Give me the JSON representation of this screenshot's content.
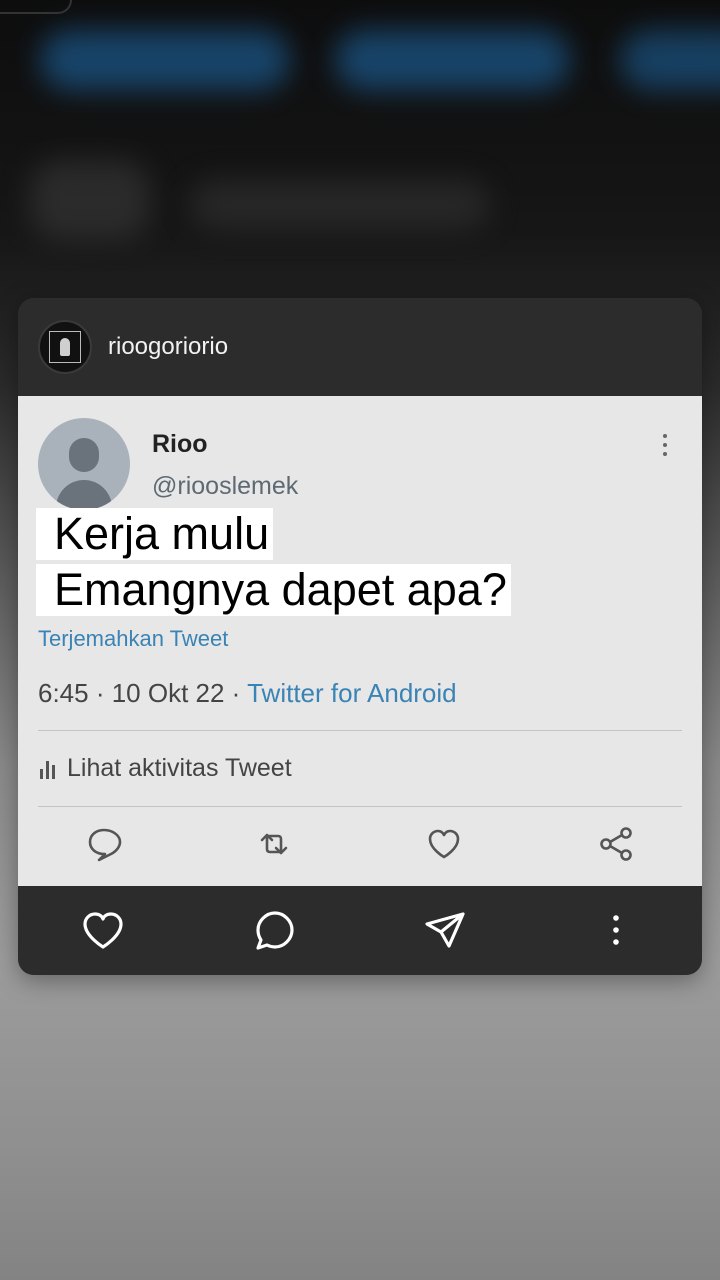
{
  "instagram": {
    "username": "rioogoriorio"
  },
  "tweet": {
    "display_name": "Rioo",
    "handle": "@riooslemek",
    "text_line1": "Kerja mulu",
    "text_line2": "Emangnya dapet apa?",
    "translate_label": "Terjemahkan Tweet",
    "time_date": "6:45 · 10 Okt 22 · ",
    "source": "Twitter for Android",
    "activity_label": "Lihat aktivitas Tweet"
  },
  "icons": {
    "tweet_actions": [
      "reply-icon",
      "retweet-icon",
      "like-icon",
      "share-icon"
    ],
    "post_actions": [
      "heart-icon",
      "comment-icon",
      "send-icon",
      "more-vertical-icon"
    ]
  },
  "colors": {
    "link_blue": "#3a83b5",
    "card_dark": "#2c2c2c",
    "tweet_bg": "#e7e7e7"
  }
}
